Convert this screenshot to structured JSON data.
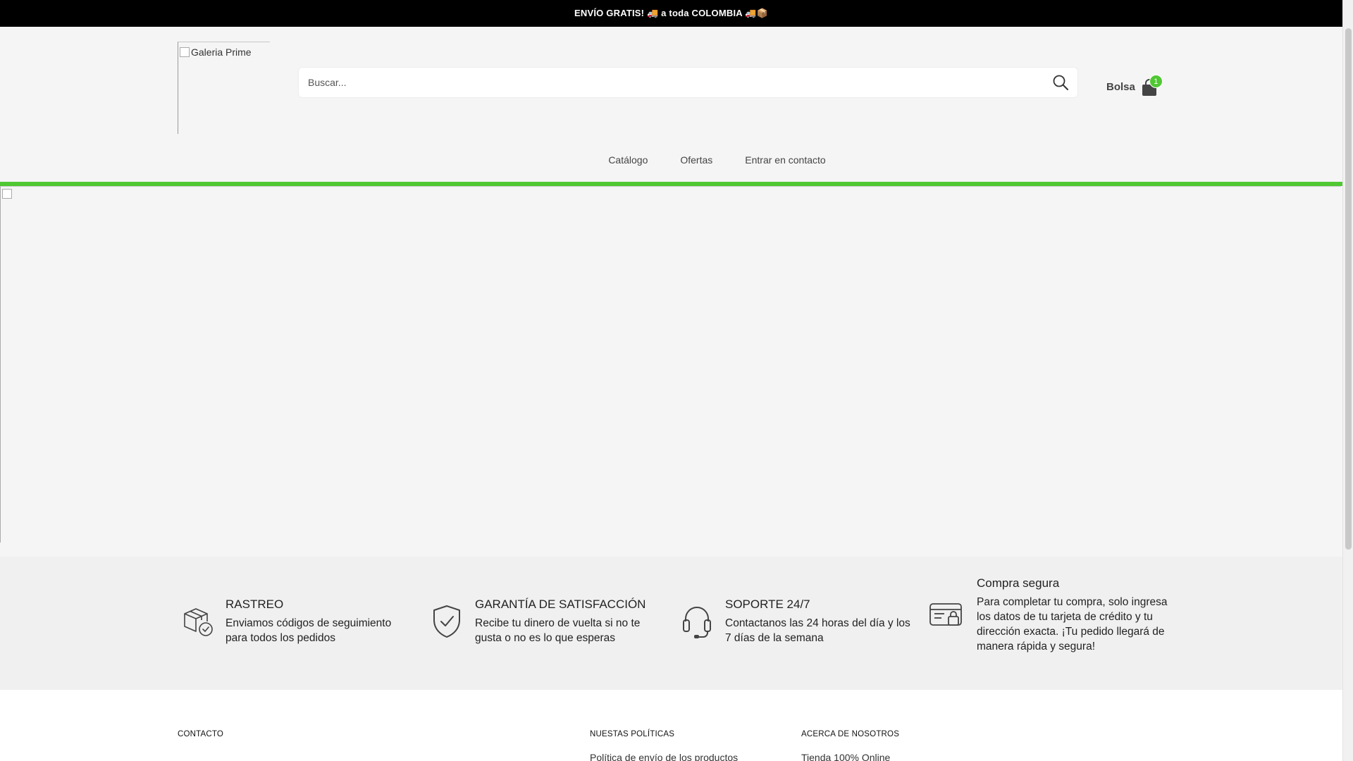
{
  "announcement": {
    "text": "ENVÍO GRATIS! 🚚 a toda COLOMBIA 🚚📦"
  },
  "header": {
    "logo_alt": "Galeria Prime",
    "search": {
      "placeholder": "Buscar..."
    },
    "cart": {
      "label": "Bolsa",
      "count": "1"
    }
  },
  "nav": {
    "items": [
      {
        "label": "Catálogo"
      },
      {
        "label": "Ofertas"
      },
      {
        "label": "Entrar en contacto"
      }
    ]
  },
  "features": [
    {
      "title": "RASTREO",
      "text": "Enviamos códigos de seguimiento para todos los pedidos",
      "icon": "package-check-icon"
    },
    {
      "title": "GARANTÍA DE SATISFACCIÓN",
      "text": "Recibe tu dinero de vuelta si no te gusta o no es lo que esperas",
      "icon": "shield-check-icon"
    },
    {
      "title": "SOPORTE 24/7",
      "text": "Contactanos las 24 horas del día y los 7 días de la semana",
      "icon": "headset-icon"
    },
    {
      "title": "Compra segura",
      "text": "Para completar tu compra, solo ingresa los datos de tu tarjeta de crédito y tu dirección exacta. ¡Tu pedido llegará de manera rápida y segura!",
      "icon": "secure-card-icon"
    }
  ],
  "footer": {
    "columns": [
      {
        "title": "CONTACTO",
        "first_link": ""
      },
      {
        "title": "NUESTAS POLÍTICAS",
        "first_link": "Política de envío de los productos"
      },
      {
        "title": "ACERCA DE NOSOTROS",
        "first_link": "Tienda 100% Online"
      }
    ]
  },
  "colors": {
    "accent": "#4fc832",
    "announcement_bg": "#000000",
    "header_bg": "#f5f5f5"
  }
}
